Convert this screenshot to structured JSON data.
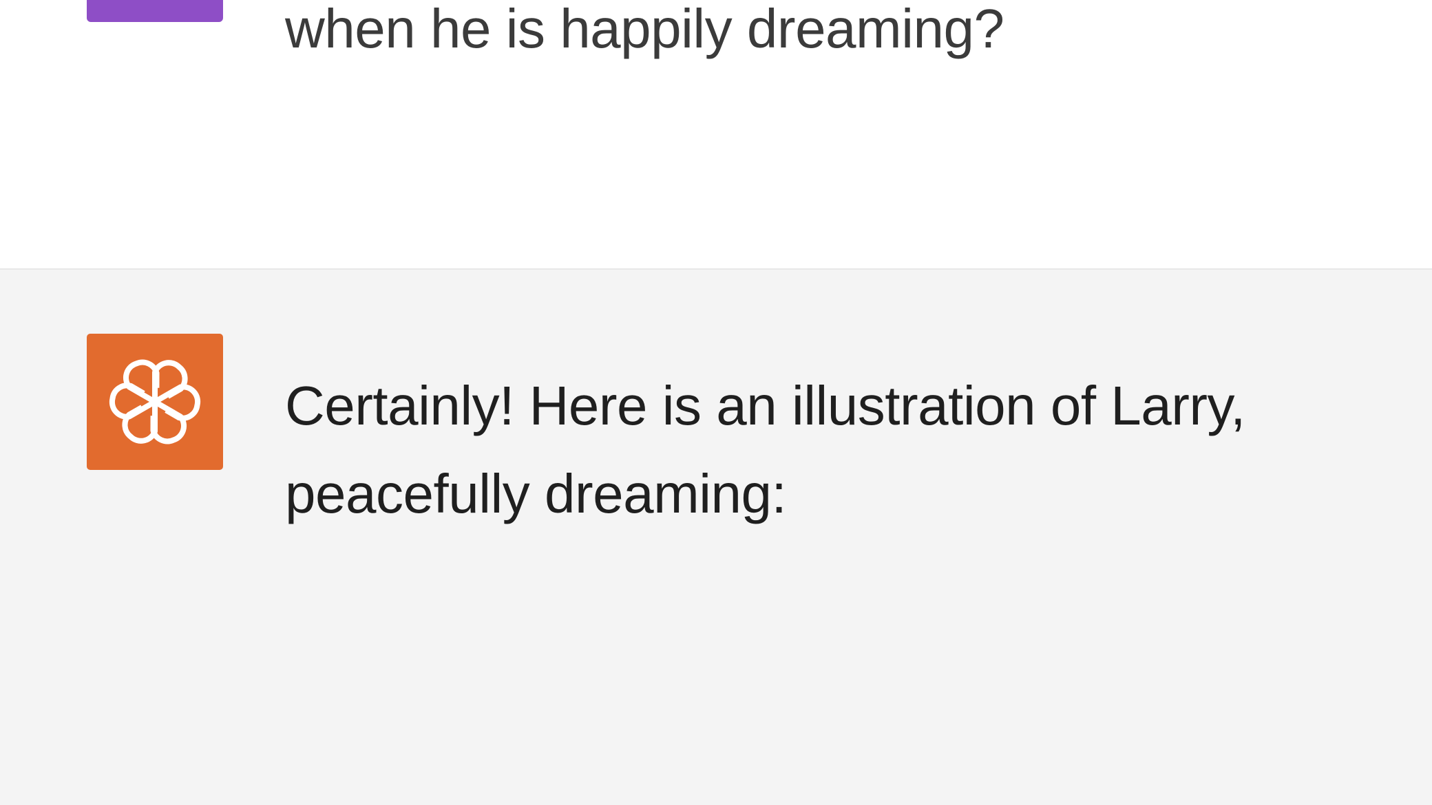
{
  "conversation": {
    "user_message": {
      "text": "when he is happily dreaming?",
      "avatar_color": "#8e4ec6"
    },
    "assistant_message": {
      "text": "Certainly! Here is an illustration of Larry,\npeacefully dreaming:",
      "avatar_icon": "openai-logo-icon",
      "avatar_color": "#e26b2e"
    }
  }
}
